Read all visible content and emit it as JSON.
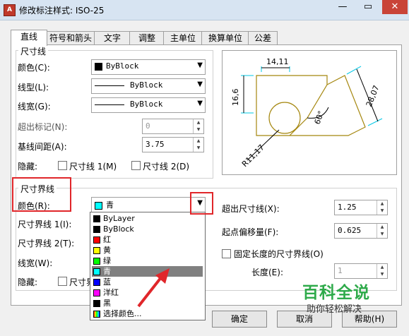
{
  "window": {
    "title": "修改标注样式: ISO-25",
    "app_icon": "A",
    "minimize": "—",
    "maximize": "▭",
    "close": "✕"
  },
  "tabs": [
    "直线",
    "符号和箭头",
    "文字",
    "调整",
    "主单位",
    "换算单位",
    "公差"
  ],
  "dim_line": {
    "group_label": "尺寸线",
    "color_label": "颜色(C):",
    "color_value": "ByBlock",
    "linetype_label": "线型(L):",
    "linetype_value": "ByBlock",
    "lineweight_label": "线宽(G):",
    "lineweight_value": "ByBlock",
    "extend_label": "超出标记(N):",
    "extend_value": "0",
    "spacing_label": "基线间距(A):",
    "spacing_value": "3.75",
    "suppress_label": "隐藏:",
    "suppress1": "尺寸线 1(M)",
    "suppress2": "尺寸线 2(D)"
  },
  "ext_line": {
    "group_label": "尺寸界线",
    "color_label": "颜色(R):",
    "color_value": "青",
    "linetype1_label": "尺寸界线 1(I):",
    "linetype2_label": "尺寸界线 2(T):",
    "lineweight_label": "线宽(W):",
    "suppress_label": "隐藏:",
    "suppress1_partial": "尺寸界",
    "extend_label": "超出尺寸线(X):",
    "extend_value": "1.25",
    "offset_label": "起点偏移量(F):",
    "offset_value": "0.625",
    "fixed_label": "固定长度的尺寸界线(O)",
    "length_label": "长度(E):",
    "length_value": "1"
  },
  "color_dropdown": {
    "options": [
      {
        "label": "ByLayer",
        "color": "#000000"
      },
      {
        "label": "ByBlock",
        "color": "#000000"
      },
      {
        "label": "红",
        "color": "#ff0000"
      },
      {
        "label": "黄",
        "color": "#ffff00"
      },
      {
        "label": "绿",
        "color": "#00ff00"
      },
      {
        "label": "青",
        "color": "#00ffff"
      },
      {
        "label": "蓝",
        "color": "#0000ff"
      },
      {
        "label": "洋红",
        "color": "#ff00ff"
      },
      {
        "label": "黑",
        "color": "#000000"
      },
      {
        "label": "选择颜色...",
        "color": "multi"
      }
    ],
    "selected": "青"
  },
  "preview": {
    "dim_top": "14,11",
    "dim_left": "16,6",
    "dim_right": "28,07",
    "dim_angle": "60°",
    "dim_radius": "R11,17"
  },
  "buttons": {
    "ok": "确定",
    "cancel": "取消",
    "help": "帮助(H)"
  },
  "watermark": {
    "title": "百科全说",
    "subtitle": "助你轻松解决"
  },
  "colors": {
    "highlight": "#e0262a",
    "shape": "#a5870f",
    "ext_line": "#00c8e6"
  }
}
